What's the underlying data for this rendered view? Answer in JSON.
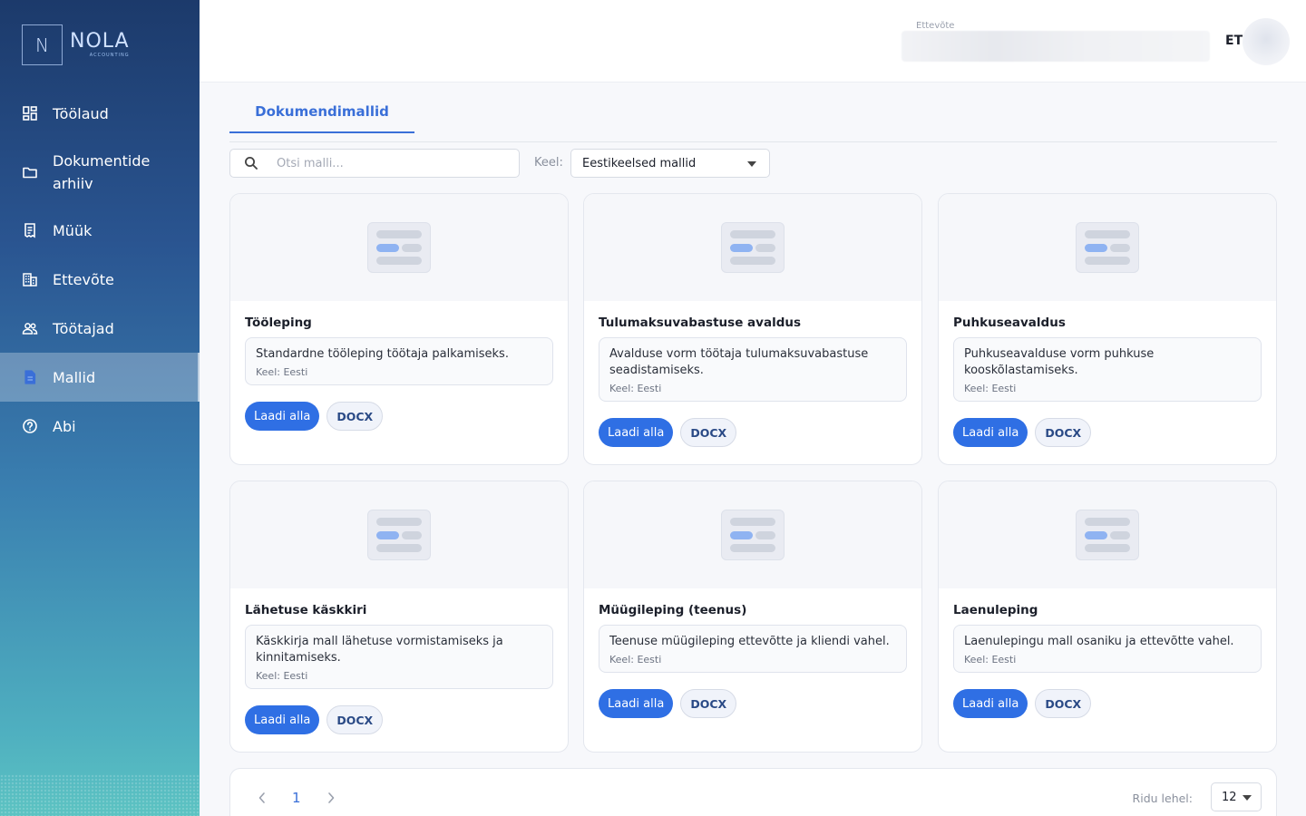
{
  "brand": {
    "letter": "N",
    "name": "NOLA",
    "sub": "ACCOUNTING"
  },
  "sidebar": {
    "items": [
      {
        "label": "Töölaud",
        "icon": "dashboard-icon"
      },
      {
        "label": "Dokumentide arhiiv",
        "icon": "folder-icon"
      },
      {
        "label": "Müük",
        "icon": "receipt-icon"
      },
      {
        "label": "Ettevõte",
        "icon": "building-icon"
      },
      {
        "label": "Töötajad",
        "icon": "people-icon"
      },
      {
        "label": "Mallid",
        "icon": "document-icon",
        "active": true
      },
      {
        "label": "Abi",
        "icon": "help-icon"
      }
    ]
  },
  "header": {
    "company_label": "Ettevõte",
    "language": "ET"
  },
  "tabs": [
    {
      "label": "Dokumendimallid",
      "active": true
    }
  ],
  "filters": {
    "search_placeholder": "Otsi malli...",
    "language_label": "Keel:",
    "language_value": "Eestikeelsed mallid"
  },
  "templates": [
    {
      "title": "Tööleping",
      "description": "Standardne tööleping töötaja palkamiseks.",
      "meta": "Keel: Eesti",
      "download": "Laadi alla",
      "format": "DOCX"
    },
    {
      "title": "Tulumaksuvabastuse avaldus",
      "description": "Avalduse vorm töötaja tulumaksuvabastuse seadistamiseks.",
      "meta": "Keel: Eesti",
      "download": "Laadi alla",
      "format": "DOCX"
    },
    {
      "title": "Puhkuseavaldus",
      "description": "Puhkuseavalduse vorm puhkuse kooskõlastamiseks.",
      "meta": "Keel: Eesti",
      "download": "Laadi alla",
      "format": "DOCX"
    },
    {
      "title": "Lähetuse käskkiri",
      "description": "Käskkirja mall lähetuse vormistamiseks ja kinnitamiseks.",
      "meta": "Keel: Eesti",
      "download": "Laadi alla",
      "format": "DOCX"
    },
    {
      "title": "Müügileping (teenus)",
      "description": "Teenuse müügileping ettevõtte ja kliendi vahel.",
      "meta": "Keel: Eesti",
      "download": "Laadi alla",
      "format": "DOCX"
    },
    {
      "title": "Laenuleping",
      "description": "Laenulepingu mall osaniku ja ettevõtte vahel.",
      "meta": "Keel: Eesti",
      "download": "Laadi alla",
      "format": "DOCX"
    }
  ],
  "pagination": {
    "current_page": "1",
    "rows_label": "Ridu lehel:",
    "rows_value": "12"
  },
  "colors": {
    "accent": "#2f6fe4",
    "tab_accent": "#3a6fd8",
    "sidebar_top": "#1c3a6b",
    "sidebar_bottom": "#5cc3c2"
  }
}
